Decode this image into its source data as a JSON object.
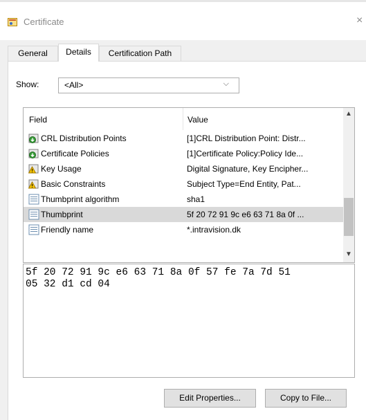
{
  "window": {
    "title": "Certificate",
    "close_glyph": "×"
  },
  "tabs": [
    {
      "label": "General",
      "active": false
    },
    {
      "label": "Details",
      "active": true
    },
    {
      "label": "Certification Path",
      "active": false
    }
  ],
  "show": {
    "label": "Show:",
    "selected": "<All>",
    "chevron": "⌵"
  },
  "list": {
    "columns": [
      "Field",
      "Value"
    ],
    "rows": [
      {
        "field": "CRL Distribution Points",
        "value": "[1]CRL Distribution Point: Distr...",
        "icon": "extension-icon",
        "selected": false
      },
      {
        "field": "Certificate Policies",
        "value": "[1]Certificate Policy:Policy Ide...",
        "icon": "extension-icon",
        "selected": false
      },
      {
        "field": "Key Usage",
        "value": "Digital Signature, Key Encipher...",
        "icon": "critical-extension-icon",
        "selected": false
      },
      {
        "field": "Basic Constraints",
        "value": "Subject Type=End Entity, Pat...",
        "icon": "critical-extension-icon",
        "selected": false
      },
      {
        "field": "Thumbprint algorithm",
        "value": "sha1",
        "icon": "property-icon",
        "selected": false
      },
      {
        "field": "Thumbprint",
        "value": "5f 20 72 91 9c e6 63 71 8a 0f ...",
        "icon": "property-icon",
        "selected": true
      },
      {
        "field": "Friendly name",
        "value": "*.intravision.dk",
        "icon": "property-icon",
        "selected": false
      }
    ],
    "scroll_up_glyph": "▲",
    "scroll_down_glyph": "▼"
  },
  "detail_value": "5f 20 72 91 9c e6 63 71 8a 0f 57 fe 7a 7d 51\n05 32 d1 cd 04",
  "buttons": {
    "edit_properties": "Edit Properties...",
    "copy_to_file": "Copy to File..."
  },
  "colors": {
    "selected_row": "#d9d9d9",
    "panel_bg": "#f0f0f0"
  }
}
